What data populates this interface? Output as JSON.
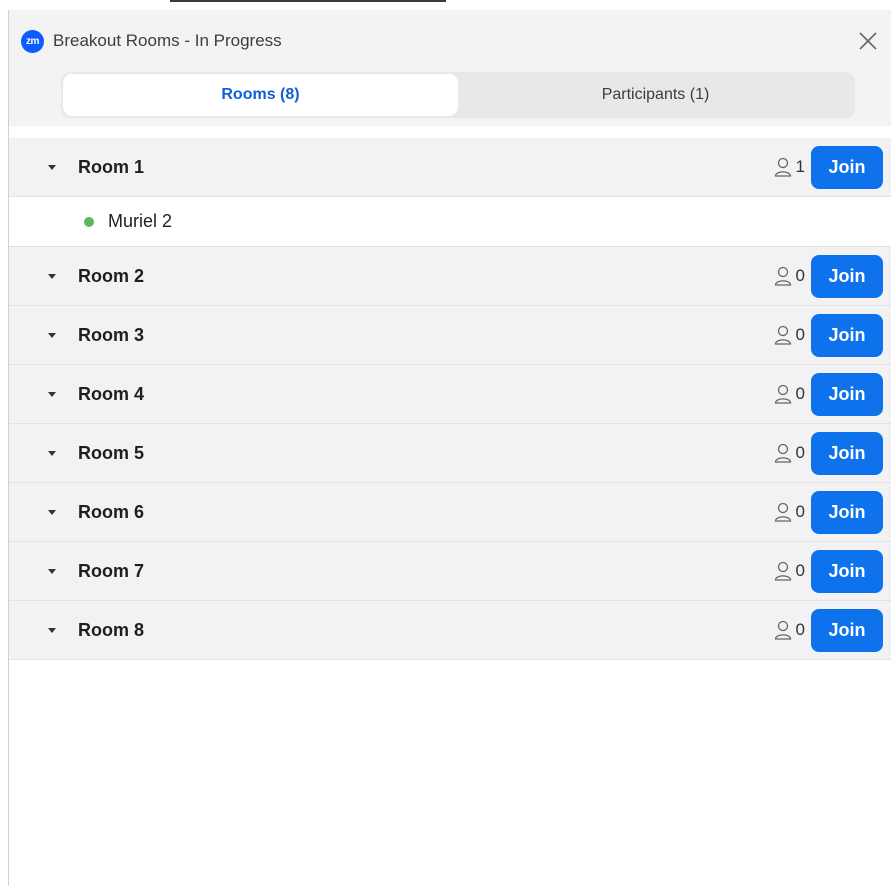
{
  "window": {
    "title": "Breakout Rooms - In Progress",
    "logo_text": "zm"
  },
  "tabs": [
    {
      "label": "Rooms (8)",
      "active": true
    },
    {
      "label": "Participants (1)",
      "active": false
    }
  ],
  "rooms": [
    {
      "name": "Room 1",
      "count": "1",
      "join_label": "Join",
      "participants": [
        {
          "name": "Muriel 2",
          "status_color": "#5cb85c"
        }
      ]
    },
    {
      "name": "Room 2",
      "count": "0",
      "join_label": "Join"
    },
    {
      "name": "Room 3",
      "count": "0",
      "join_label": "Join"
    },
    {
      "name": "Room 4",
      "count": "0",
      "join_label": "Join"
    },
    {
      "name": "Room 5",
      "count": "0",
      "join_label": "Join"
    },
    {
      "name": "Room 6",
      "count": "0",
      "join_label": "Join"
    },
    {
      "name": "Room 7",
      "count": "0",
      "join_label": "Join"
    },
    {
      "name": "Room 8",
      "count": "0",
      "join_label": "Join"
    }
  ],
  "icons": {
    "logo": "zoom-logo-icon",
    "close": "close-icon",
    "expand": "caret-down-icon",
    "person": "person-icon"
  },
  "colors": {
    "accent": "#0e72ed",
    "active_tab_text": "#0e61d8",
    "online": "#5cb85c"
  }
}
